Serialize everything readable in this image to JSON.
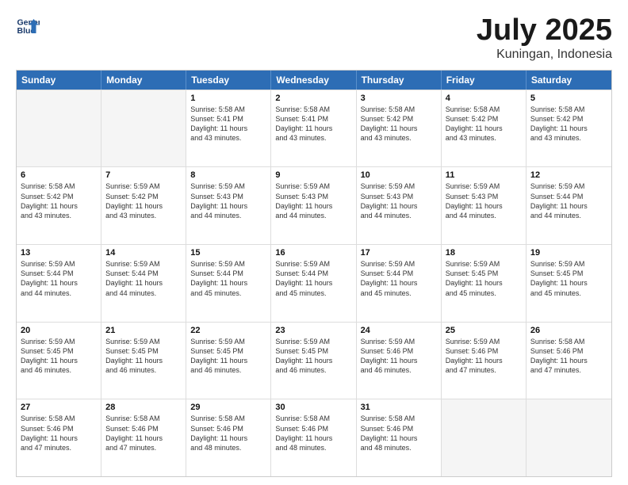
{
  "header": {
    "logo_line1": "General",
    "logo_line2": "Blue",
    "month": "July 2025",
    "location": "Kuningan, Indonesia"
  },
  "weekdays": [
    "Sunday",
    "Monday",
    "Tuesday",
    "Wednesday",
    "Thursday",
    "Friday",
    "Saturday"
  ],
  "weeks": [
    [
      {
        "day": "",
        "empty": true
      },
      {
        "day": "",
        "empty": true
      },
      {
        "day": "1",
        "lines": [
          "Sunrise: 5:58 AM",
          "Sunset: 5:41 PM",
          "Daylight: 11 hours",
          "and 43 minutes."
        ]
      },
      {
        "day": "2",
        "lines": [
          "Sunrise: 5:58 AM",
          "Sunset: 5:41 PM",
          "Daylight: 11 hours",
          "and 43 minutes."
        ]
      },
      {
        "day": "3",
        "lines": [
          "Sunrise: 5:58 AM",
          "Sunset: 5:42 PM",
          "Daylight: 11 hours",
          "and 43 minutes."
        ]
      },
      {
        "day": "4",
        "lines": [
          "Sunrise: 5:58 AM",
          "Sunset: 5:42 PM",
          "Daylight: 11 hours",
          "and 43 minutes."
        ]
      },
      {
        "day": "5",
        "lines": [
          "Sunrise: 5:58 AM",
          "Sunset: 5:42 PM",
          "Daylight: 11 hours",
          "and 43 minutes."
        ]
      }
    ],
    [
      {
        "day": "6",
        "lines": [
          "Sunrise: 5:58 AM",
          "Sunset: 5:42 PM",
          "Daylight: 11 hours",
          "and 43 minutes."
        ]
      },
      {
        "day": "7",
        "lines": [
          "Sunrise: 5:59 AM",
          "Sunset: 5:42 PM",
          "Daylight: 11 hours",
          "and 43 minutes."
        ]
      },
      {
        "day": "8",
        "lines": [
          "Sunrise: 5:59 AM",
          "Sunset: 5:43 PM",
          "Daylight: 11 hours",
          "and 44 minutes."
        ]
      },
      {
        "day": "9",
        "lines": [
          "Sunrise: 5:59 AM",
          "Sunset: 5:43 PM",
          "Daylight: 11 hours",
          "and 44 minutes."
        ]
      },
      {
        "day": "10",
        "lines": [
          "Sunrise: 5:59 AM",
          "Sunset: 5:43 PM",
          "Daylight: 11 hours",
          "and 44 minutes."
        ]
      },
      {
        "day": "11",
        "lines": [
          "Sunrise: 5:59 AM",
          "Sunset: 5:43 PM",
          "Daylight: 11 hours",
          "and 44 minutes."
        ]
      },
      {
        "day": "12",
        "lines": [
          "Sunrise: 5:59 AM",
          "Sunset: 5:44 PM",
          "Daylight: 11 hours",
          "and 44 minutes."
        ]
      }
    ],
    [
      {
        "day": "13",
        "lines": [
          "Sunrise: 5:59 AM",
          "Sunset: 5:44 PM",
          "Daylight: 11 hours",
          "and 44 minutes."
        ]
      },
      {
        "day": "14",
        "lines": [
          "Sunrise: 5:59 AM",
          "Sunset: 5:44 PM",
          "Daylight: 11 hours",
          "and 44 minutes."
        ]
      },
      {
        "day": "15",
        "lines": [
          "Sunrise: 5:59 AM",
          "Sunset: 5:44 PM",
          "Daylight: 11 hours",
          "and 45 minutes."
        ]
      },
      {
        "day": "16",
        "lines": [
          "Sunrise: 5:59 AM",
          "Sunset: 5:44 PM",
          "Daylight: 11 hours",
          "and 45 minutes."
        ]
      },
      {
        "day": "17",
        "lines": [
          "Sunrise: 5:59 AM",
          "Sunset: 5:44 PM",
          "Daylight: 11 hours",
          "and 45 minutes."
        ]
      },
      {
        "day": "18",
        "lines": [
          "Sunrise: 5:59 AM",
          "Sunset: 5:45 PM",
          "Daylight: 11 hours",
          "and 45 minutes."
        ]
      },
      {
        "day": "19",
        "lines": [
          "Sunrise: 5:59 AM",
          "Sunset: 5:45 PM",
          "Daylight: 11 hours",
          "and 45 minutes."
        ]
      }
    ],
    [
      {
        "day": "20",
        "lines": [
          "Sunrise: 5:59 AM",
          "Sunset: 5:45 PM",
          "Daylight: 11 hours",
          "and 46 minutes."
        ]
      },
      {
        "day": "21",
        "lines": [
          "Sunrise: 5:59 AM",
          "Sunset: 5:45 PM",
          "Daylight: 11 hours",
          "and 46 minutes."
        ]
      },
      {
        "day": "22",
        "lines": [
          "Sunrise: 5:59 AM",
          "Sunset: 5:45 PM",
          "Daylight: 11 hours",
          "and 46 minutes."
        ]
      },
      {
        "day": "23",
        "lines": [
          "Sunrise: 5:59 AM",
          "Sunset: 5:45 PM",
          "Daylight: 11 hours",
          "and 46 minutes."
        ]
      },
      {
        "day": "24",
        "lines": [
          "Sunrise: 5:59 AM",
          "Sunset: 5:46 PM",
          "Daylight: 11 hours",
          "and 46 minutes."
        ]
      },
      {
        "day": "25",
        "lines": [
          "Sunrise: 5:59 AM",
          "Sunset: 5:46 PM",
          "Daylight: 11 hours",
          "and 47 minutes."
        ]
      },
      {
        "day": "26",
        "lines": [
          "Sunrise: 5:58 AM",
          "Sunset: 5:46 PM",
          "Daylight: 11 hours",
          "and 47 minutes."
        ]
      }
    ],
    [
      {
        "day": "27",
        "lines": [
          "Sunrise: 5:58 AM",
          "Sunset: 5:46 PM",
          "Daylight: 11 hours",
          "and 47 minutes."
        ]
      },
      {
        "day": "28",
        "lines": [
          "Sunrise: 5:58 AM",
          "Sunset: 5:46 PM",
          "Daylight: 11 hours",
          "and 47 minutes."
        ]
      },
      {
        "day": "29",
        "lines": [
          "Sunrise: 5:58 AM",
          "Sunset: 5:46 PM",
          "Daylight: 11 hours",
          "and 48 minutes."
        ]
      },
      {
        "day": "30",
        "lines": [
          "Sunrise: 5:58 AM",
          "Sunset: 5:46 PM",
          "Daylight: 11 hours",
          "and 48 minutes."
        ]
      },
      {
        "day": "31",
        "lines": [
          "Sunrise: 5:58 AM",
          "Sunset: 5:46 PM",
          "Daylight: 11 hours",
          "and 48 minutes."
        ]
      },
      {
        "day": "",
        "empty": true
      },
      {
        "day": "",
        "empty": true
      }
    ]
  ]
}
